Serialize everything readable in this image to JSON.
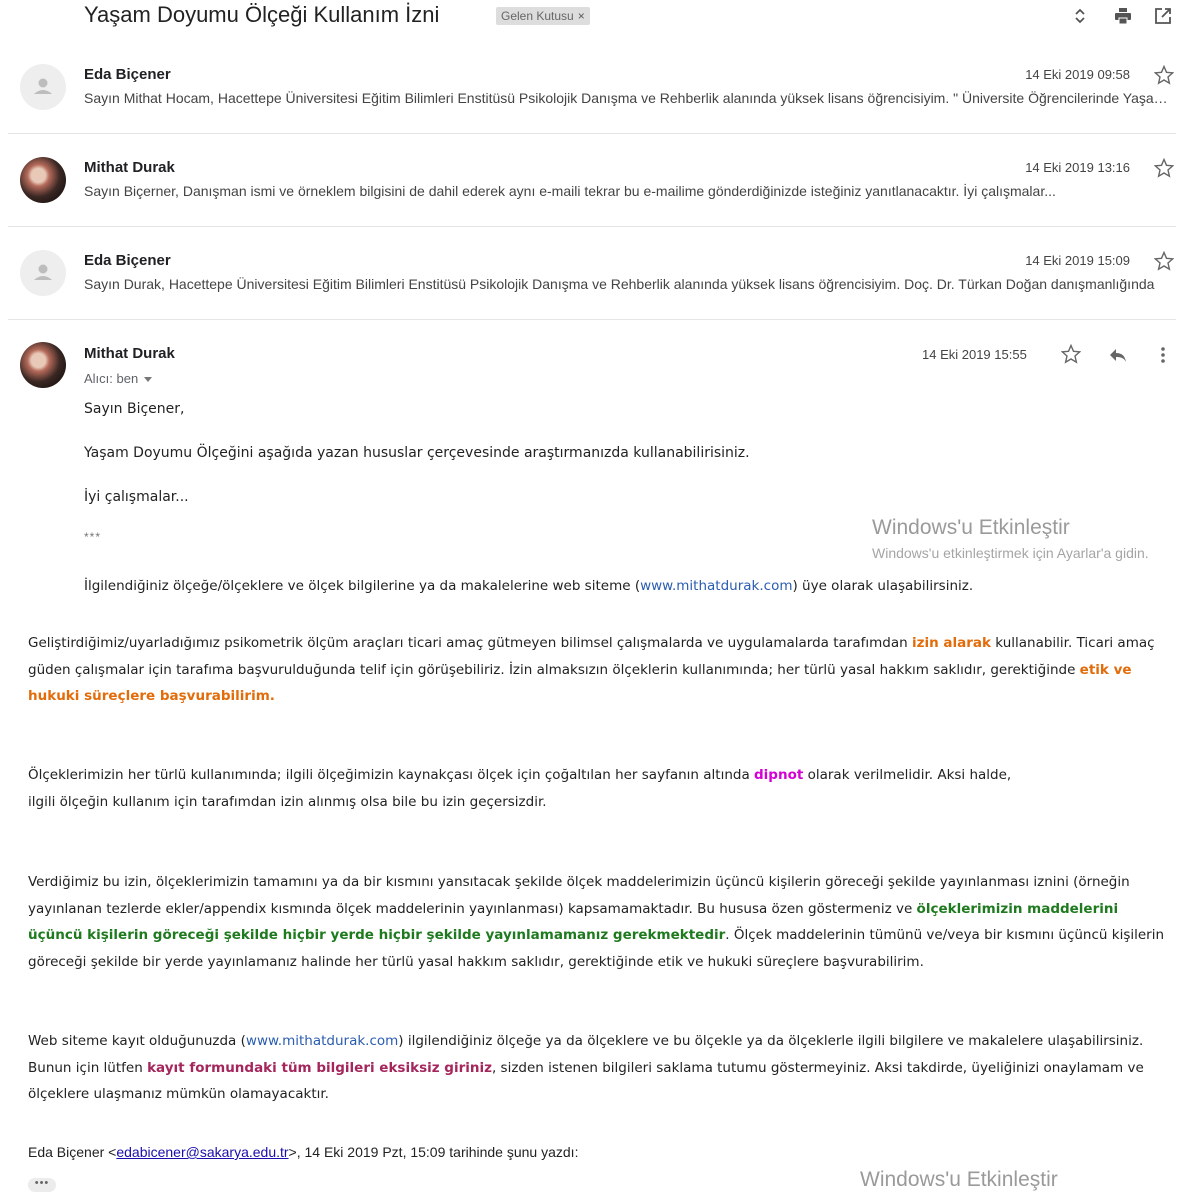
{
  "header": {
    "subject": "Yaşam Doyumu Ölçeği Kullanım İzni",
    "label": "Gelen Kutusu",
    "label_remove": "×"
  },
  "messages": [
    {
      "sender": "Eda Biçener",
      "date": "14 Eki 2019 09:58",
      "snippet": "Sayın Mithat Hocam, Hacettepe Üniversitesi Eğitim Bilimleri Enstitüsü Psikolojik Danışma ve Rehberlik alanında yüksek lisans öğrencisiyim. \" Üniversite Öğrencilerinde Yaşam Doyumu\" başlıklı",
      "avatar": "default-avatar"
    },
    {
      "sender": "Mithat Durak",
      "date": "14 Eki 2019 13:16",
      "snippet": "Sayın Biçerner, Danışman ismi ve örneklem bilgisini de dahil ederek aynı e-maili tekrar bu e-mailime gönderdiğinizde isteğiniz yanıtlanacaktır. İyi çalışmalar...",
      "avatar": "photo-avatar"
    },
    {
      "sender": "Eda Biçener",
      "date": "14 Eki 2019 15:09",
      "snippet": "Sayın Durak, Hacettepe Üniversitesi Eğitim Bilimleri Enstitüsü Psikolojik Danışma ve Rehberlik alanında yüksek lisans öğrencisiyim. Doç. Dr. Türkan Doğan danışmanlığında",
      "avatar": "default-avatar"
    }
  ],
  "open_message": {
    "sender": "Mithat Durak",
    "date": "14 Eki 2019 15:55",
    "to": "Alıcı: ben",
    "greeting": "Sayın Biçener,",
    "line1": "Yaşam Doyumu Ölçeğini aşağıda yazan hususlar çerçevesinde araştırmanızda kullanabilirisiniz.",
    "line2": "İyi çalışmalar...",
    "separator": "***",
    "site_line_pre": "İlgilendiğiniz ölçeğe/ölçeklere ve ölçek bilgilerine ya da makalelerine web siteme (",
    "site_link": "www.mithatdurak.com",
    "site_line_post": ") üye olarak ulaşabilirsiniz.",
    "p1_a": "Geliştirdiğimiz/uyarladığımız psikometrik ölçüm araçları ticari amaç gütmeyen bilimsel çalışmalarda ve uygulamalarda tarafımdan ",
    "p1_b": "izin alarak",
    "p1_c": " kullanabilir. Ticari amaç güden çalışmalar için tarafıma başvurulduğunda telif için görüşebiliriz. İzin almaksızın ölçeklerin kullanımında; her türlü yasal hakkım saklıdır, gerektiğinde ",
    "p1_d": "etik ve hukuki süreçlere başvurabilirim",
    "p1_e": ".",
    "p2_a": "Ölçeklerimizin her türlü kullanımında; ilgili ölçeğimizin kaynakçası ölçek için çoğaltılan her sayfanın altında ",
    "p2_b": "dipnot",
    "p2_c": " olarak verilmelidir. Aksi halde,",
    "p2_d": "ilgili ölçeğin kullanım için tarafımdan izin alınmış olsa bile bu izin geçersizdir.",
    "p3_a": "Verdiğimiz bu izin, ölçeklerimizin tamamını ya da bir kısmını yansıtacak şekilde ölçek maddelerimizin üçüncü kişilerin göreceği şekilde yayınlanması iznini (örneğin yayınlanan tezlerde ekler/appendix kısmında ölçek maddelerinin yayınlanması) kapsamamaktadır. Bu hususa özen göstermeniz ve ",
    "p3_b": "ölçeklerimizin maddelerini üçüncü kişilerin göreceği şekilde hiçbir yerde hiçbir şekilde yayınlamamanız gerekmektedir",
    "p3_c": ". Ölçek maddelerinin tümünü ve/veya bir kısmını üçüncü kişilerin göreceği şekilde bir yerde yayınlamanız halinde her türlü yasal hakkım saklıdır, gerektiğinde etik ve hukuki süreçlere başvurabilirim.",
    "p4_a": "Web siteme kayıt olduğunuzda  (",
    "p4_link": "www.mithatdurak.com",
    "p4_b": ")  ilgilendiğiniz ölçeğe ya da ölçeklere ve bu ölçekle ya da ölçeklerle ilgili bilgilere ve makalelere ulaşabilirsiniz. Bunun için lütfen ",
    "p4_c": "kayıt formundaki tüm bilgileri eksiksiz giriniz",
    "p4_d": ", sizden istenen bilgileri saklama tutumu göstermeyiniz. Aksi takdirde, üyeliğinizi onaylamam ve ölçeklere ulaşmanız mümkün olamayacaktır.",
    "quote_pre": "Eda Biçener <",
    "quote_email": "edabicener@sakarya.edu.tr",
    "quote_post": ">, 14 Eki 2019 Pzt, 15:09 tarihinde şunu yazdı:",
    "show_trimmed": "•••"
  },
  "watermark": {
    "title": "Windows'u Etkinleştir",
    "subtitle": "Windows'u etkinleştirmek için Ayarlar'a gidin."
  },
  "colors": {
    "orange": "#e36c0a",
    "magenta": "#d400d4",
    "green": "#1f7a1f",
    "maroon": "#a4265d",
    "link": "#2a5db0"
  },
  "icons": [
    "expand-collapse-icon",
    "print-icon",
    "open-new-window-icon",
    "star-icon",
    "reply-icon",
    "more-vert-icon",
    "person-icon"
  ]
}
